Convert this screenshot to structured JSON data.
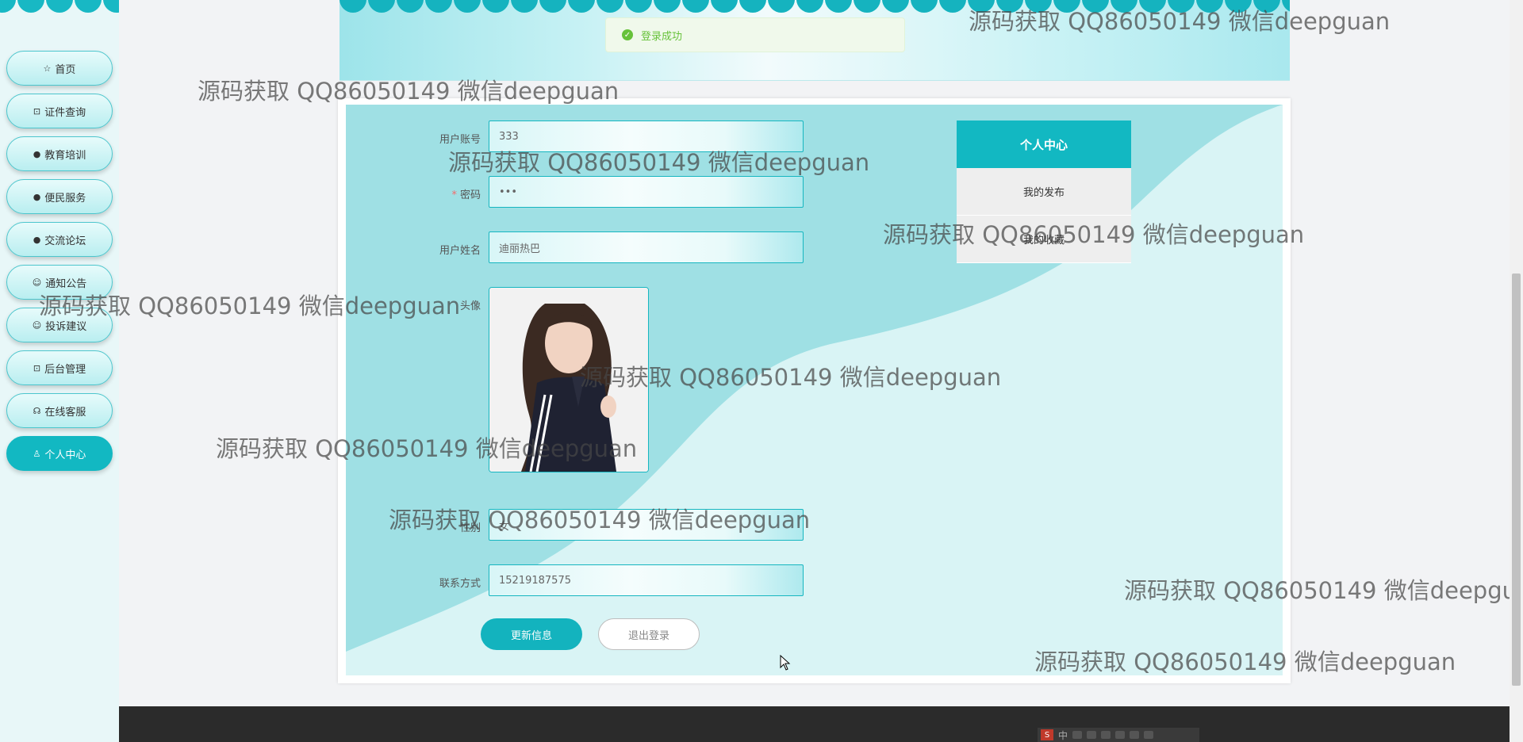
{
  "nav": {
    "items": [
      {
        "icon": "☆",
        "label": "首页",
        "active": false
      },
      {
        "icon": "⊡",
        "label": "证件查询",
        "active": false
      },
      {
        "icon": "●",
        "label": "教育培训",
        "active": false
      },
      {
        "icon": "●",
        "label": "便民服务",
        "active": false
      },
      {
        "icon": "●",
        "label": "交流论坛",
        "active": false
      },
      {
        "icon": "☺",
        "label": "通知公告",
        "active": false
      },
      {
        "icon": "☺",
        "label": "投诉建议",
        "active": false
      },
      {
        "icon": "⊡",
        "label": "后台管理",
        "active": false
      },
      {
        "icon": "☊",
        "label": "在线客服",
        "active": false
      },
      {
        "icon": "♙",
        "label": "个人中心",
        "active": true
      }
    ]
  },
  "toast": {
    "message": "登录成功",
    "check_icon": "✓"
  },
  "form": {
    "account_label": "用户账号",
    "account_value": "333",
    "password_label": "密码",
    "password_required": "*",
    "password_value": "•••",
    "name_label": "用户姓名",
    "name_value": "迪丽热巴",
    "avatar_label": "头像",
    "gender_label": "性别",
    "gender_value": "女",
    "phone_label": "联系方式",
    "phone_value": "15219187575",
    "update_button": "更新信息",
    "logout_button": "退出登录"
  },
  "personal_center": {
    "title": "个人中心",
    "items": [
      "我的发布",
      "我的收藏"
    ]
  },
  "watermark": "源码获取 QQ86050149 微信deepguan",
  "ime": {
    "label": "中"
  },
  "colors": {
    "accent": "#12b8c2",
    "panel": "#9fe0e4",
    "success": "#67c23a",
    "footer": "#2b2b2b"
  }
}
